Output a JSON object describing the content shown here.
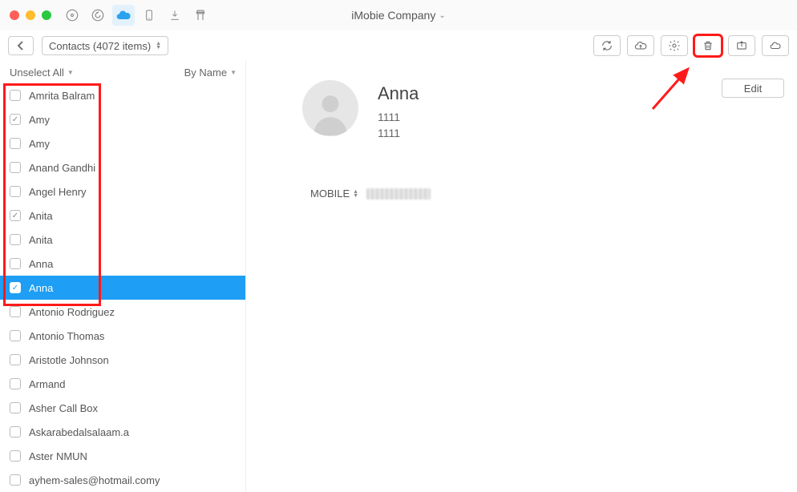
{
  "window": {
    "title": "iMobie Company"
  },
  "breadcrumb": {
    "label": "Contacts (4072 items)"
  },
  "filter": {
    "unselect": "Unselect All",
    "sort": "By Name"
  },
  "contacts": [
    {
      "name": "Amrita Balram",
      "checked": false,
      "selected": false
    },
    {
      "name": "Amy",
      "checked": true,
      "selected": false
    },
    {
      "name": "Amy",
      "checked": false,
      "selected": false
    },
    {
      "name": "Anand Gandhi",
      "checked": false,
      "selected": false
    },
    {
      "name": "Angel Henry",
      "checked": false,
      "selected": false
    },
    {
      "name": "Anita",
      "checked": true,
      "selected": false
    },
    {
      "name": "Anita",
      "checked": false,
      "selected": false
    },
    {
      "name": "Anna",
      "checked": false,
      "selected": false
    },
    {
      "name": "Anna",
      "checked": true,
      "selected": true
    },
    {
      "name": "Antonio Rodriguez",
      "checked": false,
      "selected": false
    },
    {
      "name": "Antonio Thomas",
      "checked": false,
      "selected": false
    },
    {
      "name": "Aristotle Johnson",
      "checked": false,
      "selected": false
    },
    {
      "name": "Armand",
      "checked": false,
      "selected": false
    },
    {
      "name": "Asher Call Box",
      "checked": false,
      "selected": false
    },
    {
      "name": "Askarabedalsalaam.a",
      "checked": false,
      "selected": false
    },
    {
      "name": "Aster NMUN",
      "checked": false,
      "selected": false
    },
    {
      "name": "ayhem-sales@hotmail.comy",
      "checked": false,
      "selected": false
    }
  ],
  "detail": {
    "name": "Anna",
    "line1": "1111",
    "line2": "1111",
    "mobile_label": "MOBILE",
    "edit": "Edit"
  }
}
